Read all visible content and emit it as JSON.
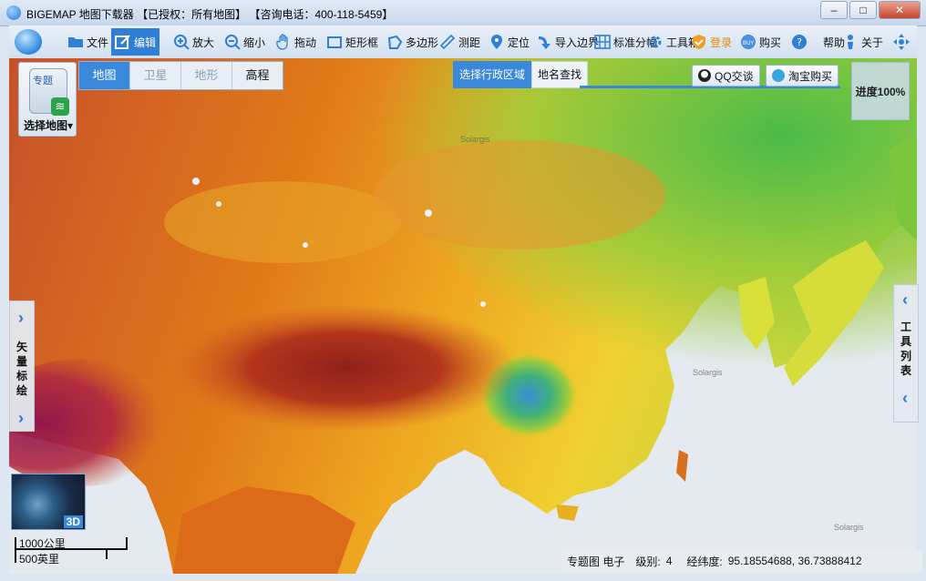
{
  "window": {
    "title": "BIGEMAP 地图下载器 【已授权：所有地图】 【咨询电话：400-118-5459】",
    "controls": [
      "–",
      "□",
      "✕"
    ]
  },
  "toolbar": {
    "items": [
      {
        "label": "文件",
        "icon": "folder-icon"
      },
      {
        "label": "编辑",
        "icon": "edit-icon",
        "active": true
      },
      {
        "label": "放大",
        "icon": "zoom-in-icon"
      },
      {
        "label": "缩小",
        "icon": "zoom-out-icon"
      },
      {
        "label": "拖动",
        "icon": "hand-icon"
      },
      {
        "label": "矩形框",
        "icon": "rectangle-select-icon"
      },
      {
        "label": "多边形",
        "icon": "polygon-icon"
      },
      {
        "label": "测距",
        "icon": "ruler-icon"
      },
      {
        "label": "定位",
        "icon": "location-pin-icon"
      },
      {
        "label": "导入边界",
        "icon": "import-arrow-icon"
      },
      {
        "label": "标准分幅",
        "icon": "grid-icon"
      },
      {
        "label": "工具箱",
        "icon": "gear-icon"
      },
      {
        "label": "登录",
        "icon": "login-shield-icon"
      },
      {
        "label": "购买",
        "icon": "buy-icon"
      },
      {
        "label": "帮助",
        "icon": "help-icon"
      },
      {
        "label": "关于",
        "icon": "about-icon"
      }
    ]
  },
  "map_type": {
    "icon_tag": "专题",
    "label": "选择地图"
  },
  "tabs": [
    "地图",
    "卫星",
    "地形",
    "高程"
  ],
  "search_tabs": [
    "选择行政区域",
    "地名查找"
  ],
  "qq_button": "QQ交谈",
  "taobao_button": "淘宝购买",
  "progress": "进度100%",
  "left_panel": {
    "label": [
      "矢",
      "量",
      "标",
      "绘"
    ]
  },
  "right_panel": {
    "label": [
      "工",
      "具",
      "列",
      "表"
    ]
  },
  "thumb_3d": "3D",
  "scale": {
    "km": "1000公里",
    "mi": "500英里"
  },
  "status": {
    "map_name": "专题图 电子",
    "level_label": "级别:",
    "level_value": "4",
    "coord_label": "经纬度:",
    "coord_value": "95.18554688, 36.73888412"
  },
  "watermarks": [
    "Solargis",
    "Solargis",
    "Solargis"
  ],
  "colors": {
    "accent": "#3a88dc",
    "login": "#e08a00"
  }
}
